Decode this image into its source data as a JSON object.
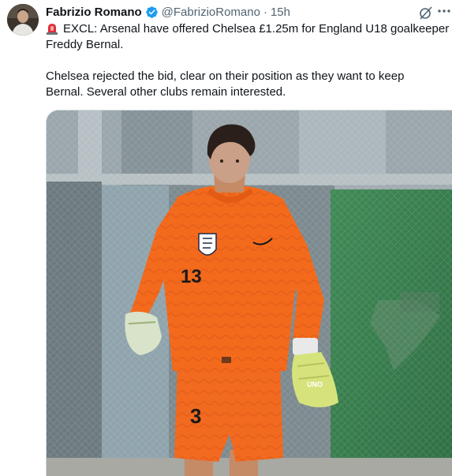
{
  "tweet": {
    "author_name": "Fabrizio Romano",
    "handle": "@FabrizioRomano",
    "separator": "·",
    "time": "15h",
    "line1": "EXCL: Arsenal have offered Chelsea £1.25m for England U18 goalkeeper",
    "line2": "Freddy Bernal.",
    "line3": "Chelsea rejected the bid, clear on their position as they want to keep",
    "line4": "Bernal. Several other clubs remain interested."
  },
  "photo": {
    "shirt_number": "13",
    "shorts_number": "3",
    "glove_text": "UNO"
  },
  "colors": {
    "verified": "#1d9bf0",
    "kit": "#f46a1c",
    "muted_text": "#536471"
  }
}
